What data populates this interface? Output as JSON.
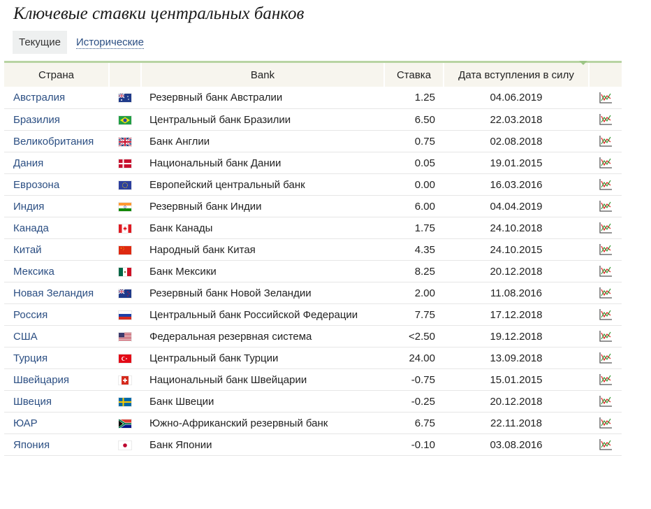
{
  "page": {
    "title": "Ключевые ставки центральных банков"
  },
  "tabs": [
    {
      "label": "Текущие",
      "active": true
    },
    {
      "label": "Исторические",
      "active": false
    }
  ],
  "table": {
    "headers": {
      "country": "Страна",
      "flag": "",
      "bank": "Bank",
      "rate": "Ставка",
      "date": "Дата вступления в силу",
      "chart": ""
    },
    "rows": [
      {
        "country": "Австралия",
        "flag": "australia-flag-icon",
        "bank": "Резервный банк Австралии",
        "rate": "1.25",
        "date": "04.06.2019"
      },
      {
        "country": "Бразилия",
        "flag": "brazil-flag-icon",
        "bank": "Центральный банк Бразилии",
        "rate": "6.50",
        "date": "22.03.2018"
      },
      {
        "country": "Великобритания",
        "flag": "uk-flag-icon",
        "bank": "Банк Англии",
        "rate": "0.75",
        "date": "02.08.2018"
      },
      {
        "country": "Дания",
        "flag": "denmark-flag-icon",
        "bank": "Национальный банк Дании",
        "rate": "0.05",
        "date": "19.01.2015"
      },
      {
        "country": "Еврозона",
        "flag": "eu-flag-icon",
        "bank": "Европейский центральный банк",
        "rate": "0.00",
        "date": "16.03.2016"
      },
      {
        "country": "Индия",
        "flag": "india-flag-icon",
        "bank": "Резервный банк Индии",
        "rate": "6.00",
        "date": "04.04.2019"
      },
      {
        "country": "Канада",
        "flag": "canada-flag-icon",
        "bank": "Банк Канады",
        "rate": "1.75",
        "date": "24.10.2018"
      },
      {
        "country": "Китай",
        "flag": "china-flag-icon",
        "bank": "Народный банк Китая",
        "rate": "4.35",
        "date": "24.10.2015"
      },
      {
        "country": "Мексика",
        "flag": "mexico-flag-icon",
        "bank": "Банк Мексики",
        "rate": "8.25",
        "date": "20.12.2018"
      },
      {
        "country": "Новая Зеландия",
        "flag": "new-zealand-flag-icon",
        "bank": "Резервный банк Новой Зеландии",
        "rate": "2.00",
        "date": "11.08.2016"
      },
      {
        "country": "Россия",
        "flag": "russia-flag-icon",
        "bank": "Центральный банк Российской Федерации",
        "rate": "7.75",
        "date": "17.12.2018"
      },
      {
        "country": "США",
        "flag": "usa-flag-icon",
        "bank": "Федеральная резервная система",
        "rate": "<2.50",
        "date": "19.12.2018"
      },
      {
        "country": "Турция",
        "flag": "turkey-flag-icon",
        "bank": "Центральный банк Турции",
        "rate": "24.00",
        "date": "13.09.2018"
      },
      {
        "country": "Швейцария",
        "flag": "switzerland-flag-icon",
        "bank": "Национальный банк Швейцарии",
        "rate": "-0.75",
        "date": "15.01.2015"
      },
      {
        "country": "Швеция",
        "flag": "sweden-flag-icon",
        "bank": "Банк Швеции",
        "rate": "-0.25",
        "date": "20.12.2018"
      },
      {
        "country": "ЮАР",
        "flag": "south-africa-flag-icon",
        "bank": "Южно-Африканский резервный банк",
        "rate": "6.75",
        "date": "22.11.2018"
      },
      {
        "country": "Япония",
        "flag": "japan-flag-icon",
        "bank": "Банк Японии",
        "rate": "-0.10",
        "date": "03.08.2016"
      }
    ]
  },
  "colors": {
    "link": "#2c4f83",
    "header_bg": "#f7f5ee",
    "accent_green": "#b8d4a3",
    "tab_active_bg": "#eef0f0"
  },
  "icons": {
    "chart": "chart-icon",
    "sort": "sort-arrow-icon"
  }
}
